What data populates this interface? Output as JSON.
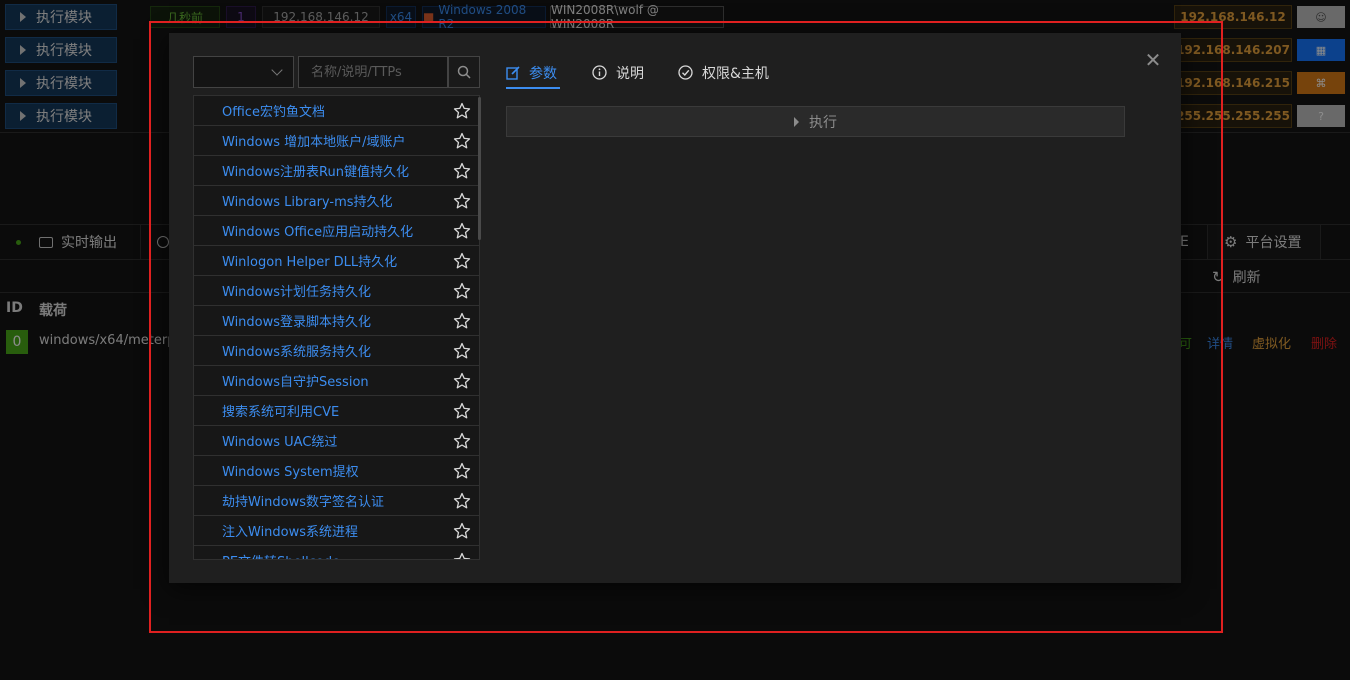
{
  "background": {
    "exec_buttons": [
      "执行模块",
      "执行模块",
      "执行模块",
      "执行模块"
    ],
    "session_tags": {
      "time": "几秒前",
      "count": "1",
      "ip": "192.168.146.12",
      "arch": "x64",
      "os": "Windows 2008 R2",
      "user": "WIN2008R\\wolf @ WIN2008R"
    },
    "ips_right": [
      "192.168.146.12",
      "192.168.146.207",
      "192.168.146.215",
      "255.255.255.255"
    ],
    "os_icons": [
      "linux-icon",
      "windows-icon",
      "osx-icon",
      "unknown-icon"
    ],
    "tabs": {
      "realtime_output": "实时输出",
      "partial_tab": "E",
      "platform_settings": "平台设置"
    },
    "refresh": "刷新",
    "table": {
      "headers": [
        "ID",
        "载荷"
      ],
      "row": {
        "id": "0",
        "payload": "windows/x64/meterp",
        "actions": [
          "详情",
          "虚拟化",
          "删除"
        ],
        "partial_action": "可"
      }
    }
  },
  "modal": {
    "search_placeholder": "名称/说明/TTPs",
    "tabs": [
      "参数",
      "说明",
      "权限&主机"
    ],
    "active_tab": 0,
    "execute_label": "执行",
    "modules": [
      "Office宏钓鱼文档",
      "Windows 增加本地账户/域账户",
      "Windows注册表Run键值持久化",
      "Windows Library-ms持久化",
      "Windows Office应用启动持久化",
      "Winlogon Helper DLL持久化",
      "Windows计划任务持久化",
      "Windows登录脚本持久化",
      "Windows系统服务持久化",
      "Windows自守护Session",
      "搜索系统可利用CVE",
      "Windows UAC绕过",
      "Windows System提权",
      "劫持Windows数字签名认证",
      "注入Windows系统进程",
      "PE文件转Shellcode"
    ]
  },
  "colors": {
    "accent": "#3c8df0",
    "ip_orange": "#e8a33d",
    "frame_red": "#e02020",
    "id_green": "#49aa19"
  }
}
